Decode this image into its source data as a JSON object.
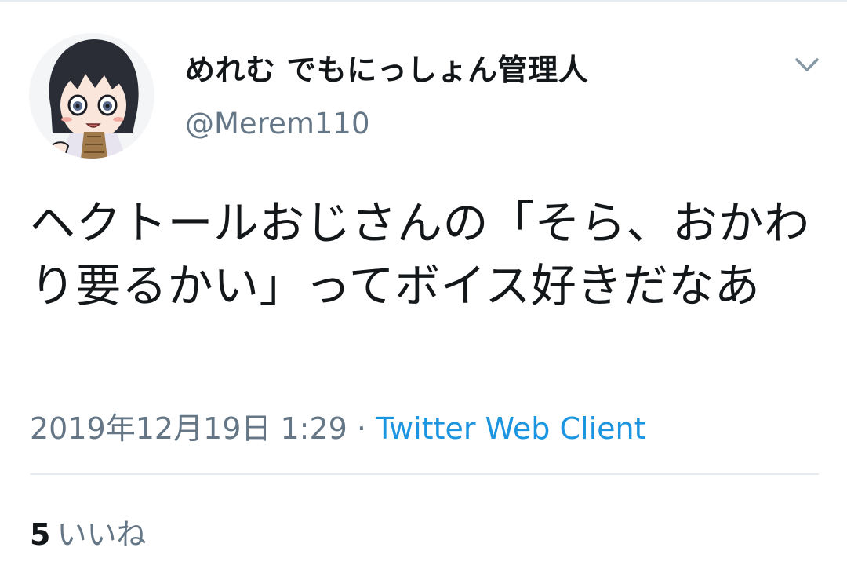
{
  "tweet": {
    "author": {
      "display_name": "めれむ でもにっしょん管理人",
      "handle": "@Merem110"
    },
    "text": "ヘクトールおじさんの「そら、おかわり要るかい」ってボイス好きだなあ",
    "timestamp": "2019年12月19日 1:29",
    "separator": "·",
    "source": "Twitter Web Client",
    "likes": {
      "count": "5",
      "label": "いいね"
    }
  },
  "icons": {
    "avatar": "anime-character-avatar",
    "menu": "chevron-down-icon"
  },
  "colors": {
    "text_primary": "#14171a",
    "text_secondary": "#657786",
    "link": "#1b95e0",
    "divider": "#e6ecf0"
  }
}
